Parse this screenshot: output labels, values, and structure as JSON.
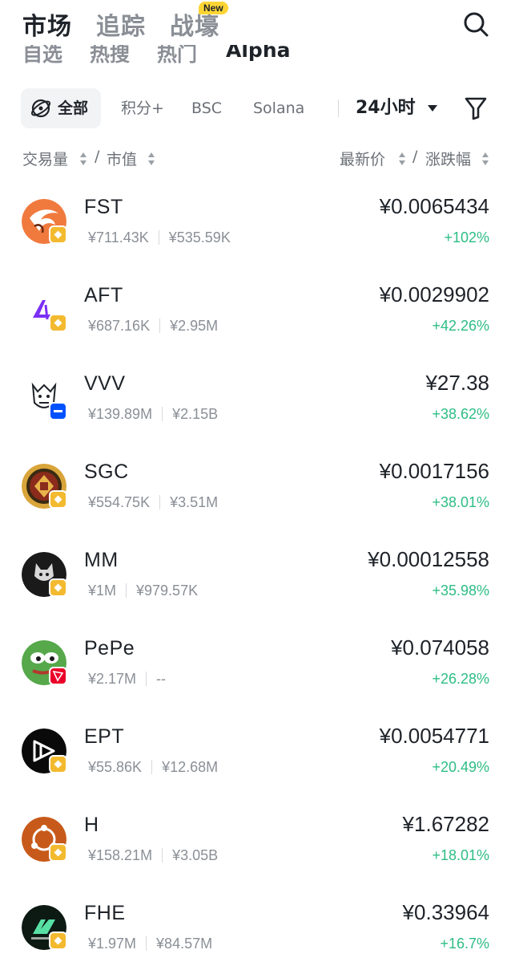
{
  "topnav": {
    "tabs": [
      "市场",
      "追踪",
      "战壕"
    ],
    "new_badge": "New"
  },
  "subtabs": [
    "自选",
    "热搜",
    "热门",
    "Alpha"
  ],
  "filters": {
    "chips": [
      "全部",
      "积分+",
      "BSC",
      "Solana"
    ],
    "period": "24小时"
  },
  "columns": {
    "left_a": "交易量",
    "left_sep": "/",
    "left_b": "市值",
    "right_a": "最新价",
    "right_sep": "/",
    "right_b": "涨跌幅"
  },
  "colors": {
    "up": "#2ebd85",
    "bnb_badge": "#f3ba2f",
    "base_badge": "#0052ff",
    "tron_badge": "#eb0029"
  },
  "tokens": [
    {
      "symbol": "FST",
      "volume": "¥711.43K",
      "mcap": "¥535.59K",
      "price": "¥0.0065434",
      "change": "+102%",
      "chain_icon": "bnb-chain-icon"
    },
    {
      "symbol": "AFT",
      "volume": "¥687.16K",
      "mcap": "¥2.95M",
      "price": "¥0.0029902",
      "change": "+42.26%",
      "chain_icon": "bnb-chain-icon"
    },
    {
      "symbol": "VVV",
      "volume": "¥139.89M",
      "mcap": "¥2.15B",
      "price": "¥27.38",
      "change": "+38.62%",
      "chain_icon": "base-chain-icon"
    },
    {
      "symbol": "SGC",
      "volume": "¥554.75K",
      "mcap": "¥3.51M",
      "price": "¥0.0017156",
      "change": "+38.01%",
      "chain_icon": "bnb-chain-icon"
    },
    {
      "symbol": "MM",
      "volume": "¥1M",
      "mcap": "¥979.57K",
      "price": "¥0.00012558",
      "change": "+35.98%",
      "chain_icon": "bnb-chain-icon"
    },
    {
      "symbol": "PePe",
      "volume": "¥2.17M",
      "mcap": "--",
      "price": "¥0.074058",
      "change": "+26.28%",
      "chain_icon": "tron-chain-icon"
    },
    {
      "symbol": "EPT",
      "volume": "¥55.86K",
      "mcap": "¥12.68M",
      "price": "¥0.0054771",
      "change": "+20.49%",
      "chain_icon": "bnb-chain-icon"
    },
    {
      "symbol": "H",
      "volume": "¥158.21M",
      "mcap": "¥3.05B",
      "price": "¥1.67282",
      "change": "+18.01%",
      "chain_icon": "bnb-chain-icon"
    },
    {
      "symbol": "FHE",
      "volume": "¥1.97M",
      "mcap": "¥84.57M",
      "price": "¥0.33964",
      "change": "+16.7%",
      "chain_icon": "bnb-chain-icon"
    }
  ]
}
